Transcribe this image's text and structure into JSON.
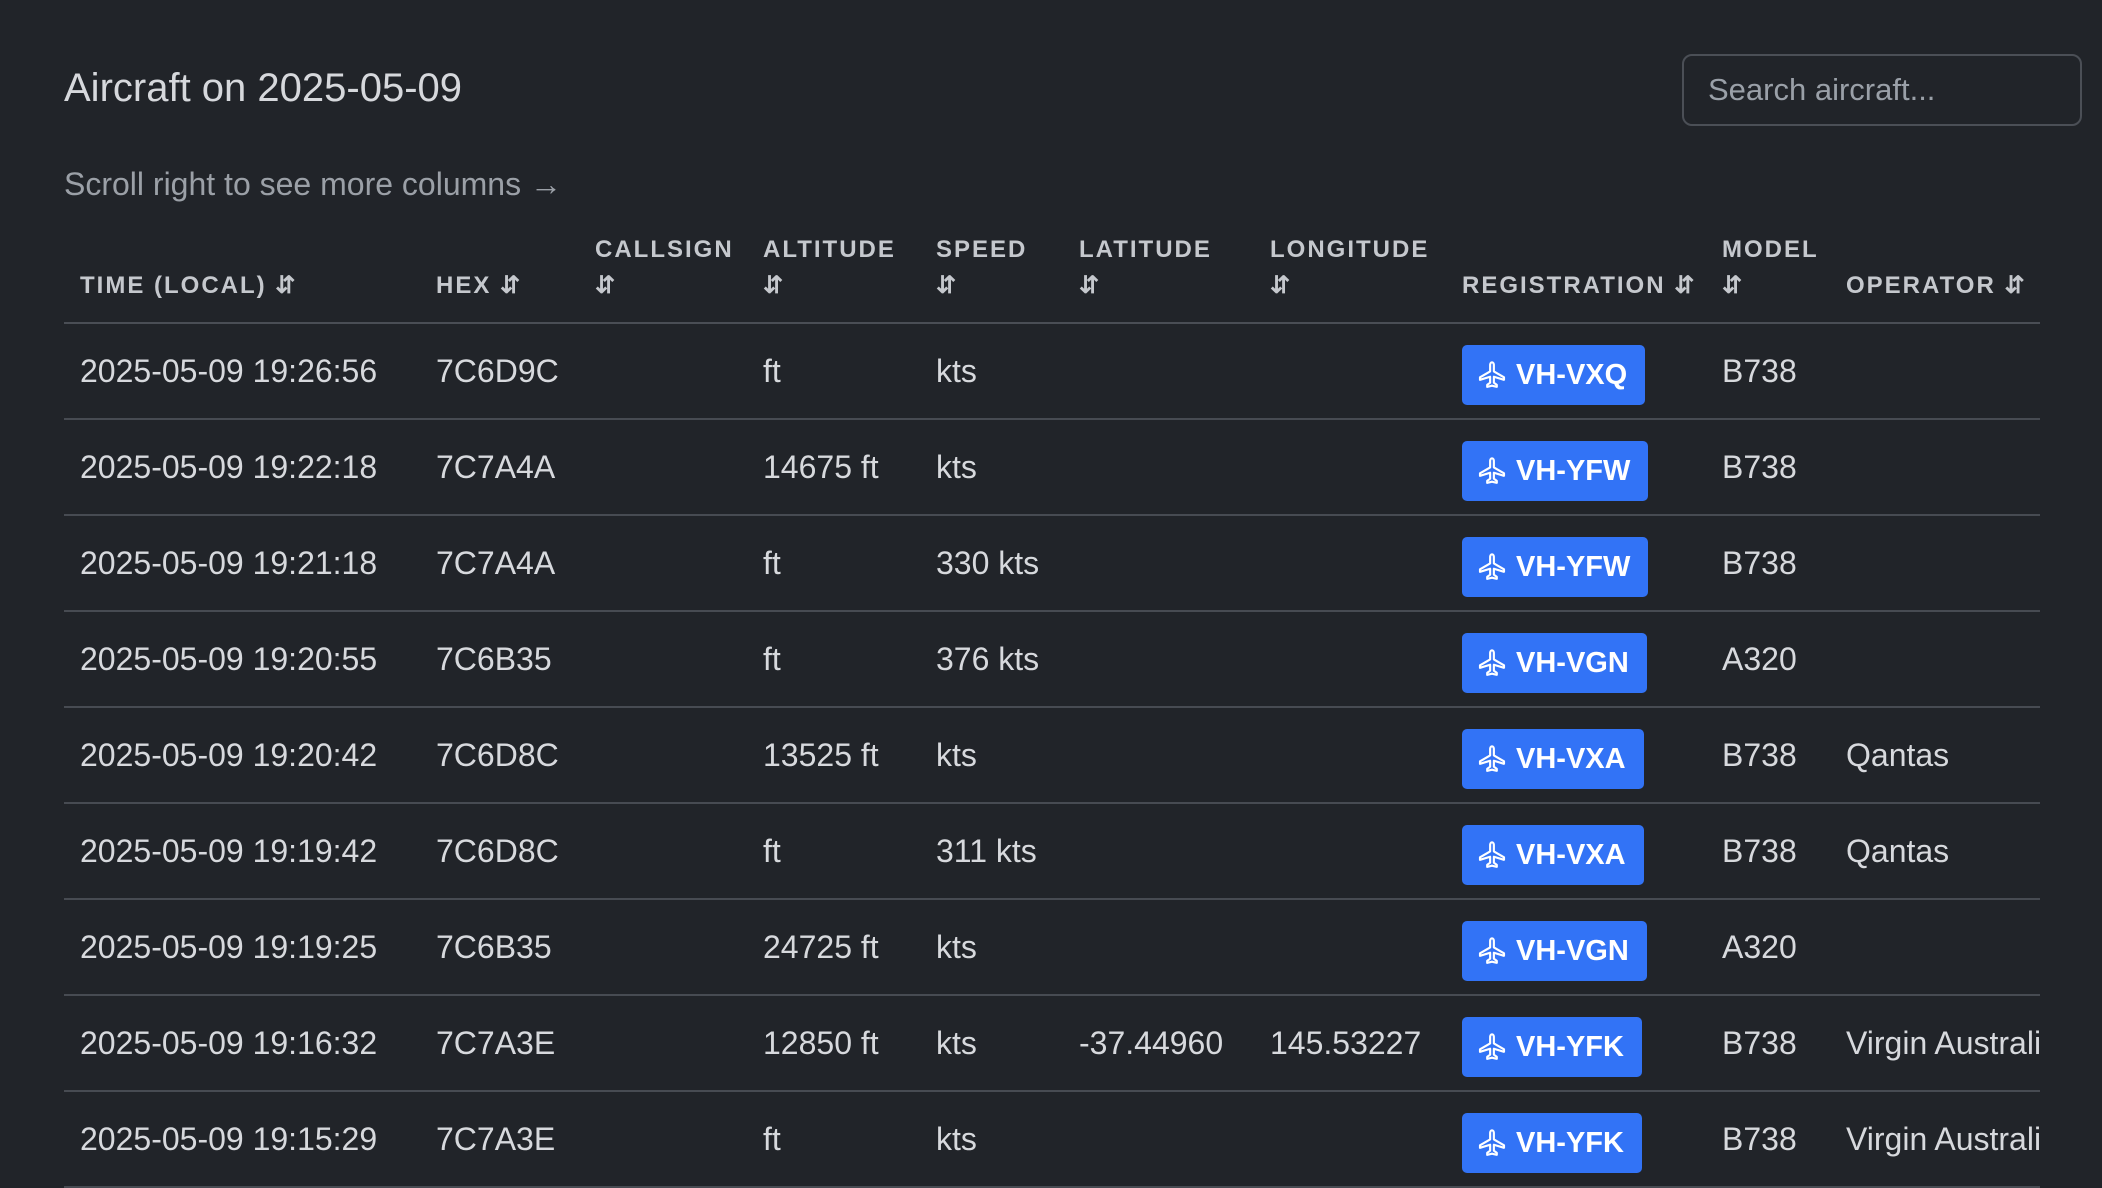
{
  "title": "Aircraft on 2025-05-09",
  "search": {
    "placeholder": "Search aircraft..."
  },
  "hint": "Scroll right to see more columns →",
  "columns": [
    {
      "label_line1": "",
      "label_line2": "TIME (LOCAL) ⇵"
    },
    {
      "label_line1": "",
      "label_line2": "HEX ⇵"
    },
    {
      "label_line1": "CALLSIGN",
      "label_line2": "⇵"
    },
    {
      "label_line1": "ALTITUDE",
      "label_line2": "⇵"
    },
    {
      "label_line1": "SPEED",
      "label_line2": "⇵"
    },
    {
      "label_line1": "LATITUDE",
      "label_line2": "⇵"
    },
    {
      "label_line1": "LONGITUDE",
      "label_line2": "⇵"
    },
    {
      "label_line1": "",
      "label_line2": "REGISTRATION ⇵"
    },
    {
      "label_line1": "MODEL",
      "label_line2": "⇵"
    },
    {
      "label_line1": "",
      "label_line2": "OPERATOR ⇵"
    }
  ],
  "rows": [
    {
      "time": "2025-05-09 19:26:56",
      "hex": "7C6D9C",
      "callsign": "",
      "altitude": "ft",
      "speed": "kts",
      "latitude": "",
      "longitude": "",
      "registration": "VH-VXQ",
      "model": "B738",
      "operator": ""
    },
    {
      "time": "2025-05-09 19:22:18",
      "hex": "7C7A4A",
      "callsign": "",
      "altitude": "14675 ft",
      "speed": "kts",
      "latitude": "",
      "longitude": "",
      "registration": "VH-YFW",
      "model": "B738",
      "operator": ""
    },
    {
      "time": "2025-05-09 19:21:18",
      "hex": "7C7A4A",
      "callsign": "",
      "altitude": "ft",
      "speed": "330 kts",
      "latitude": "",
      "longitude": "",
      "registration": "VH-YFW",
      "model": "B738",
      "operator": ""
    },
    {
      "time": "2025-05-09 19:20:55",
      "hex": "7C6B35",
      "callsign": "",
      "altitude": "ft",
      "speed": "376 kts",
      "latitude": "",
      "longitude": "",
      "registration": "VH-VGN",
      "model": "A320",
      "operator": ""
    },
    {
      "time": "2025-05-09 19:20:42",
      "hex": "7C6D8C",
      "callsign": "",
      "altitude": "13525 ft",
      "speed": "kts",
      "latitude": "",
      "longitude": "",
      "registration": "VH-VXA",
      "model": "B738",
      "operator": "Qantas"
    },
    {
      "time": "2025-05-09 19:19:42",
      "hex": "7C6D8C",
      "callsign": "",
      "altitude": "ft",
      "speed": "311 kts",
      "latitude": "",
      "longitude": "",
      "registration": "VH-VXA",
      "model": "B738",
      "operator": "Qantas"
    },
    {
      "time": "2025-05-09 19:19:25",
      "hex": "7C6B35",
      "callsign": "",
      "altitude": "24725 ft",
      "speed": "kts",
      "latitude": "",
      "longitude": "",
      "registration": "VH-VGN",
      "model": "A320",
      "operator": ""
    },
    {
      "time": "2025-05-09 19:16:32",
      "hex": "7C7A3E",
      "callsign": "",
      "altitude": "12850 ft",
      "speed": "kts",
      "latitude": "-37.44960",
      "longitude": "145.53227",
      "registration": "VH-YFK",
      "model": "B738",
      "operator": "Virgin Australia"
    },
    {
      "time": "2025-05-09 19:15:29",
      "hex": "7C7A3E",
      "callsign": "",
      "altitude": "ft",
      "speed": "kts",
      "latitude": "",
      "longitude": "",
      "registration": "VH-YFK",
      "model": "B738",
      "operator": "Virgin Australia"
    }
  ],
  "colors": {
    "background": "#212429",
    "badge": "#3273f6",
    "border": "#474b52"
  },
  "icons": {
    "registration_badge": "plane-icon"
  }
}
